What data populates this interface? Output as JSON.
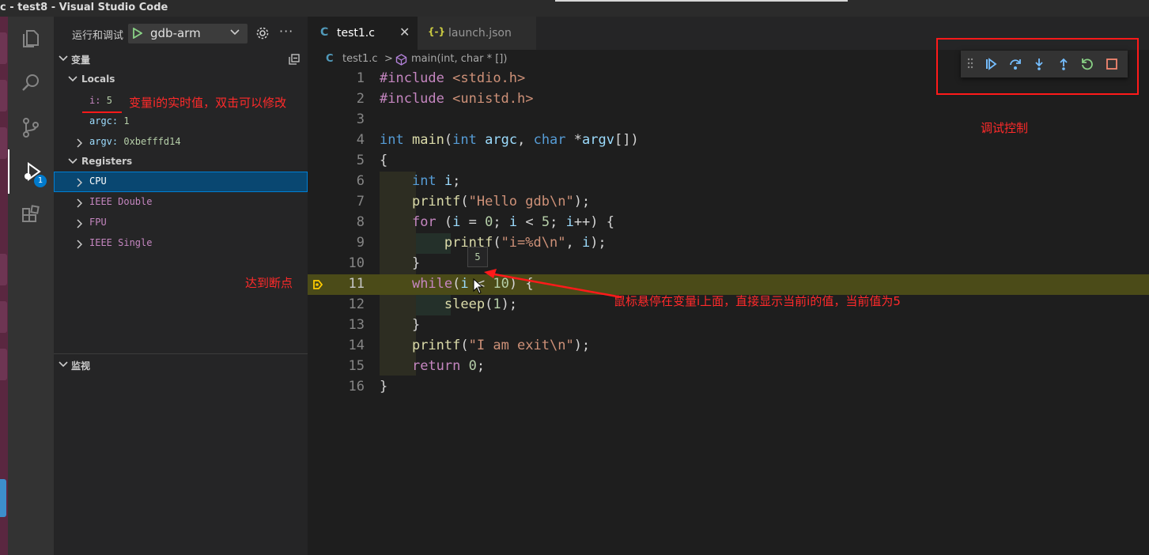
{
  "window": {
    "title": "c - test8 - Visual Studio Code"
  },
  "activity": {
    "explorer": "files-icon",
    "search": "search-icon",
    "scm": "source-control-icon",
    "debug": "run-debug-icon",
    "debug_badge": "1",
    "extensions": "extensions-icon"
  },
  "sidebar": {
    "title": "运行和调试",
    "config": "gdb-arm",
    "more": "···",
    "variables_header": "变量",
    "locals_header": "Locals",
    "locals": [
      {
        "name": "i:",
        "value": "5"
      },
      {
        "name": "argc:",
        "value": "1"
      },
      {
        "name": "argv:",
        "value": "0xbefffd14"
      }
    ],
    "registers_header": "Registers",
    "registers": [
      "CPU",
      "IEEE Double",
      "FPU",
      "IEEE Single"
    ],
    "watch_header": "监视"
  },
  "tabs": [
    {
      "icon": "C",
      "label": "test1.c",
      "close": "✕"
    },
    {
      "icon": "{-}",
      "label": "launch.json"
    }
  ],
  "breadcrumb": {
    "file_icon": "C",
    "file": "test1.c",
    "sep": ">",
    "symbol": "main(int, char * [])"
  },
  "editor": {
    "line_numbers": [
      "1",
      "2",
      "3",
      "4",
      "5",
      "6",
      "7",
      "8",
      "9",
      "10",
      "11",
      "12",
      "13",
      "14",
      "15",
      "16"
    ],
    "current_line": 11,
    "hover_value": "5"
  },
  "debug_toolbar": {
    "buttons": [
      "continue-icon",
      "step-over-icon",
      "step-into-icon",
      "step-out-icon",
      "restart-icon",
      "stop-icon"
    ]
  },
  "annotations": {
    "variable_note": "变量i的实时值，双击可以修改",
    "breakpoint_note": "达到断点",
    "hover_note": "鼠标悬停在变量i上面，直接显示当前i的值，当前值为5",
    "debug_control_note": "调试控制"
  },
  "colors": {
    "accent": "#007acc",
    "annotation_red": "#ff2a2a",
    "current_line": "#4b4b18"
  }
}
